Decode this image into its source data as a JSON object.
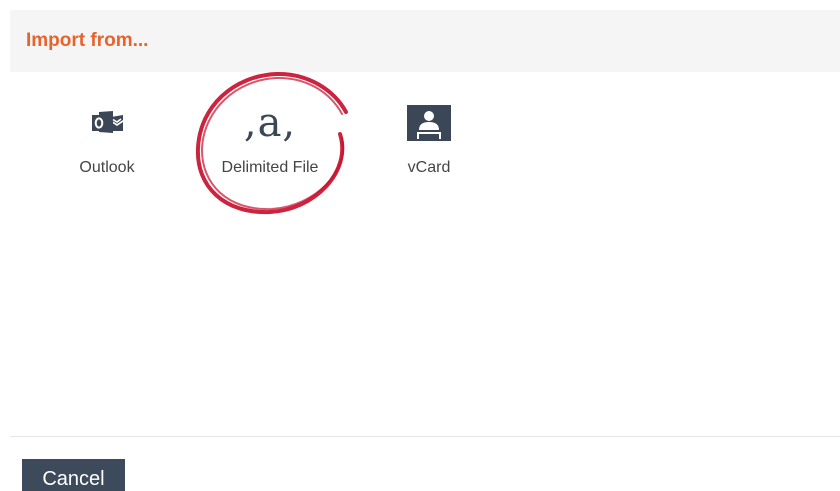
{
  "dialog": {
    "title": "Import from..."
  },
  "options": [
    {
      "label": "Outlook",
      "icon": "outlook-icon"
    },
    {
      "label": "Delimited File",
      "icon": "delimited-file-icon",
      "glyph": ",a,"
    },
    {
      "label": "vCard",
      "icon": "vcard-icon"
    }
  ],
  "footer": {
    "cancel_label": "Cancel"
  },
  "colors": {
    "title": "#e8622c",
    "header_bg": "#f5f5f5",
    "icon": "#3b4656",
    "button_bg": "#3d4a5c",
    "annotation": "#c8102e"
  }
}
